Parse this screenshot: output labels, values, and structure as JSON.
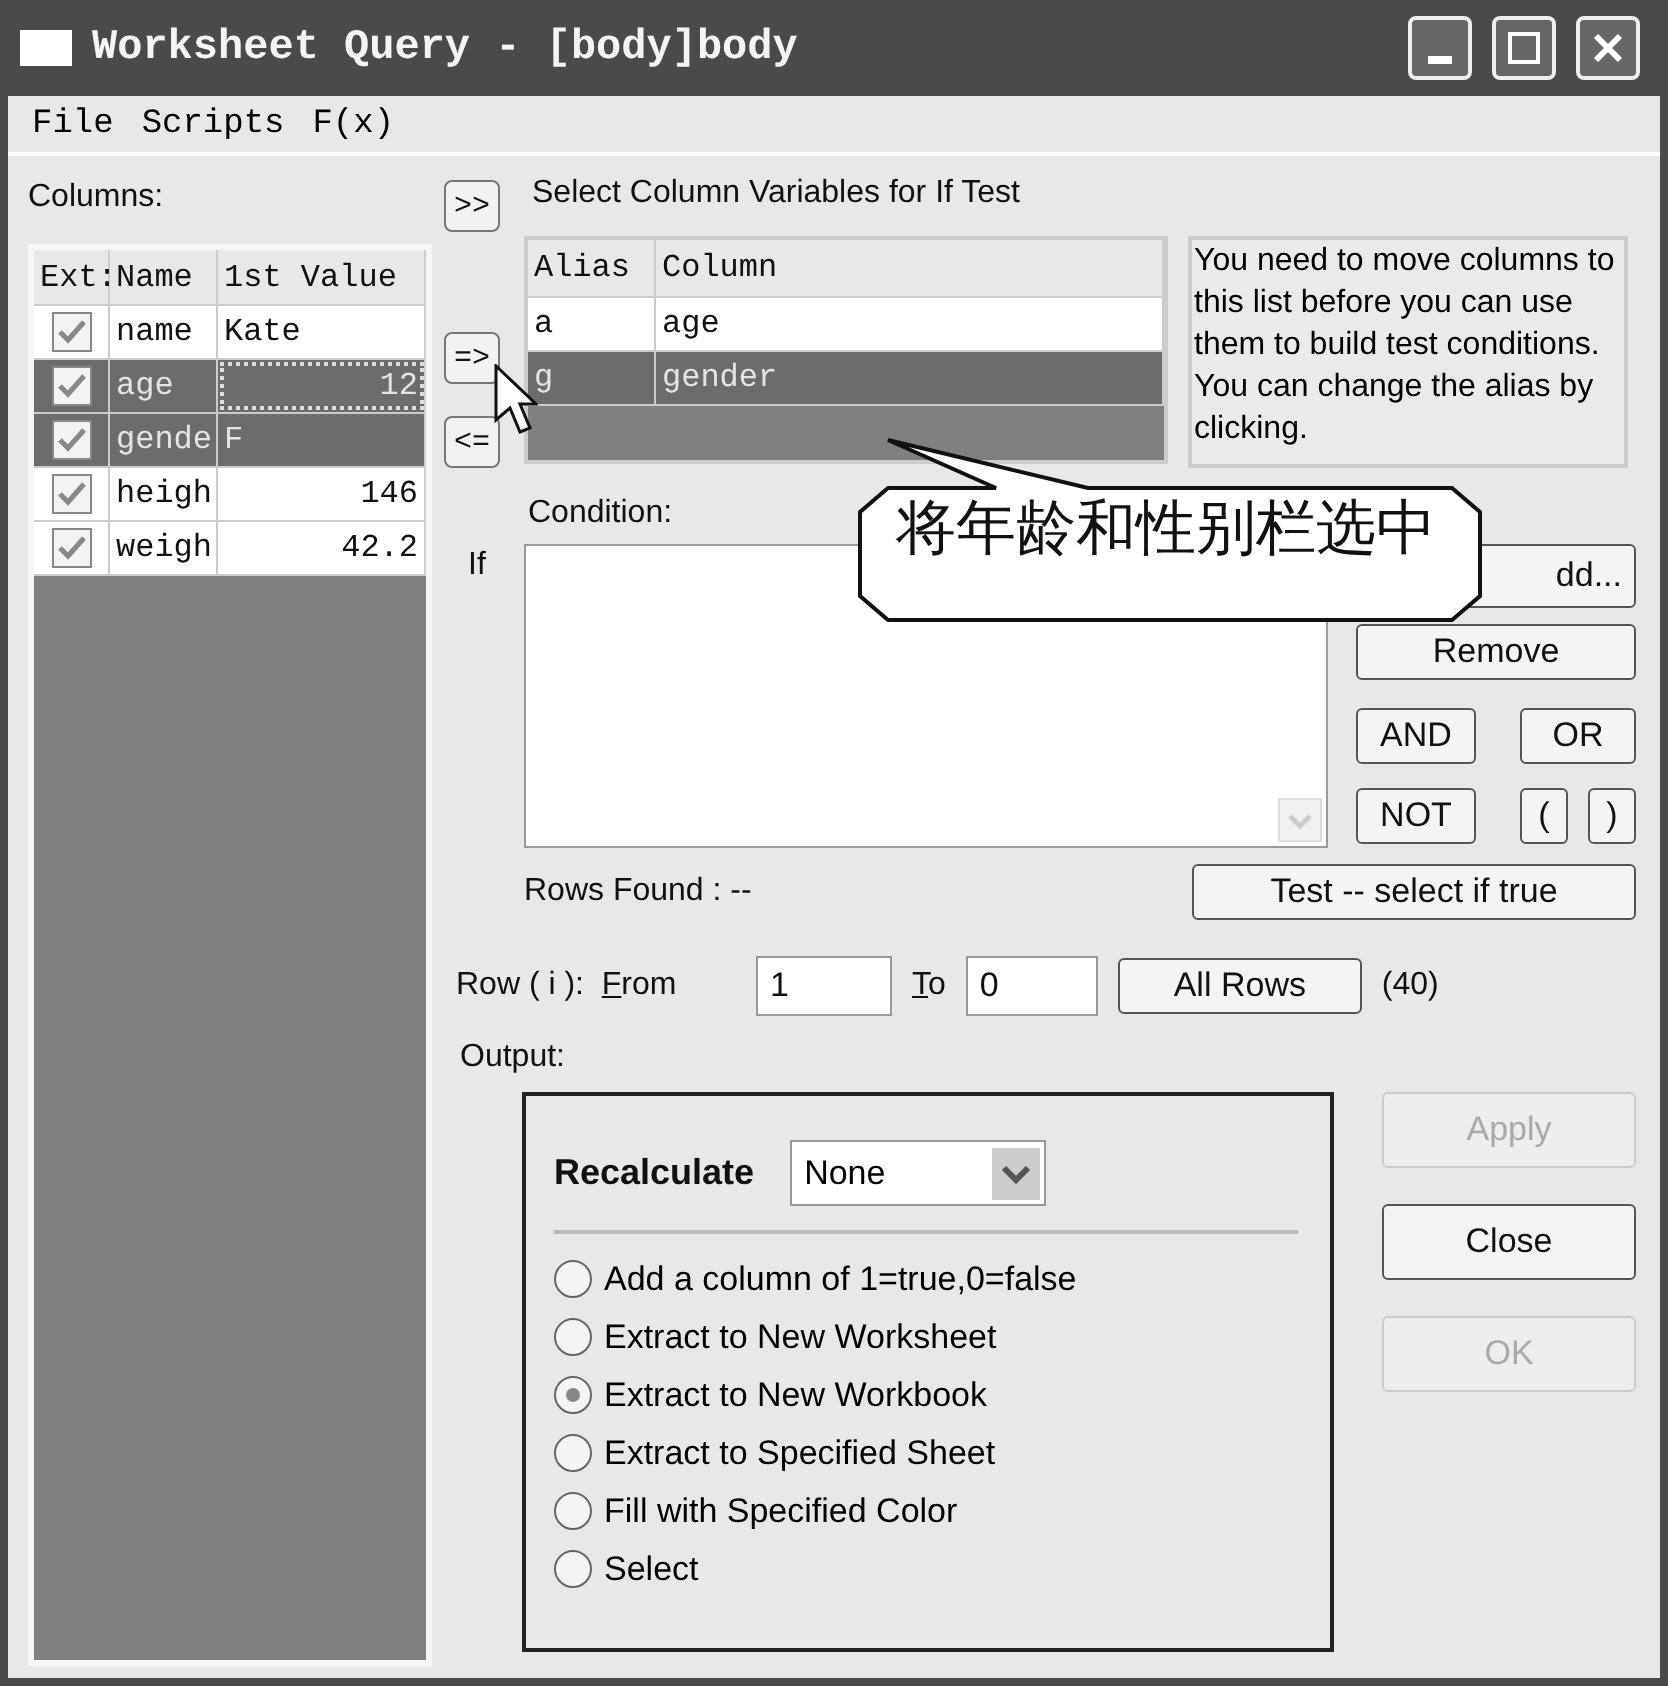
{
  "window": {
    "title": "Worksheet Query - [body]body"
  },
  "menu": [
    "File",
    "Scripts",
    "F(x)"
  ],
  "columns_panel": {
    "label": "Columns:",
    "headers": [
      "Ext:",
      "Name",
      "1st Value"
    ],
    "rows": [
      {
        "checked": true,
        "selected": false,
        "focused": false,
        "name": "name",
        "value": "Kate",
        "kind": "text"
      },
      {
        "checked": true,
        "selected": true,
        "focused": true,
        "name": "age",
        "value": "12",
        "kind": "number"
      },
      {
        "checked": true,
        "selected": true,
        "focused": false,
        "name": "gende",
        "value": "F",
        "kind": "text"
      },
      {
        "checked": true,
        "selected": false,
        "focused": false,
        "name": "heigh",
        "value": "146",
        "kind": "number"
      },
      {
        "checked": true,
        "selected": false,
        "focused": false,
        "name": "weigh",
        "value": "42.2",
        "kind": "number"
      }
    ]
  },
  "transfer_buttons": [
    ">>",
    "=>",
    "<="
  ],
  "variables": {
    "title": "Select Column Variables for If Test",
    "headers": [
      "Alias",
      "Column"
    ],
    "rows": [
      {
        "alias": "a",
        "column": "age",
        "selected": false
      },
      {
        "alias": "g",
        "column": "gender",
        "selected": true
      }
    ]
  },
  "help_text": "You need to move columns to this list before you can use them to build test conditions. You can change the alias by clicking.",
  "condition": {
    "label": "Condition:",
    "if_label": "If"
  },
  "condition_buttons": [
    "dd...",
    "Remove",
    "AND",
    "OR",
    "NOT",
    "(",
    ")"
  ],
  "rows_found": "Rows Found : --",
  "test_button": "Test -- select if true",
  "row_range": {
    "label": "Row ( i ):",
    "from_label": "From",
    "from_value": "1",
    "to_label": "To",
    "to_value": "0",
    "all_rows_button": "All Rows",
    "count": "(40)"
  },
  "output": {
    "label": "Output:",
    "recalculate_label": "Recalculate",
    "recalculate_value": "None",
    "options": [
      {
        "label": "Add a column of 1=true,0=false",
        "selected": false
      },
      {
        "label": "Extract to New Worksheet",
        "selected": false
      },
      {
        "label": "Extract to New Workbook",
        "selected": true
      },
      {
        "label": "Extract to Specified Sheet",
        "selected": false
      },
      {
        "label": "Fill with Specified Color",
        "selected": false
      },
      {
        "label": "Select",
        "selected": false
      }
    ]
  },
  "dialog_buttons": [
    {
      "label": "Apply",
      "disabled": true
    },
    {
      "label": "Close",
      "disabled": false
    },
    {
      "label": "OK",
      "disabled": true
    }
  ],
  "callout": "将年龄和性别栏选中"
}
